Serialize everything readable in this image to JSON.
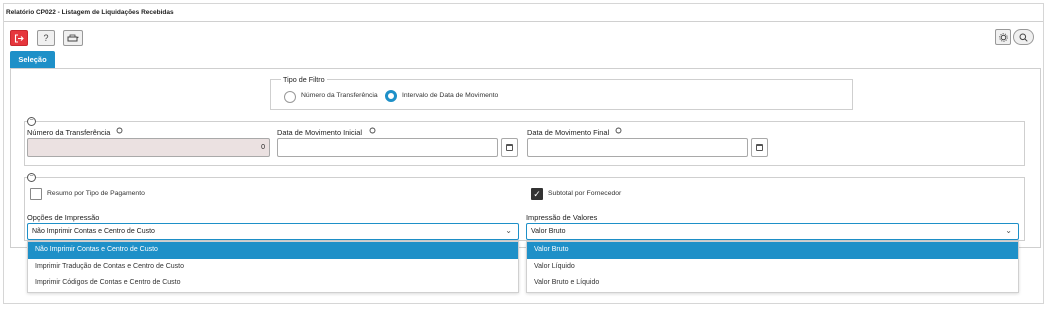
{
  "window": {
    "title": "Relatório CP022 - Listagem de Liquidações Recebidas"
  },
  "toolbar": {
    "exit_icon": "exit-icon",
    "help_label": "?",
    "print_icon": "printer-icon",
    "settings_icon": "gear-icon",
    "search_icon": "search-icon"
  },
  "tabs": [
    {
      "label": "Seleção"
    }
  ],
  "filter_type": {
    "legend": "Tipo de Filtro",
    "options": [
      {
        "label": "Número da Transferência",
        "selected": false
      },
      {
        "label": "Intervalo de Data de Movimento",
        "selected": true
      }
    ]
  },
  "fields": {
    "numero_transferencia": {
      "label": "Número da Transferência",
      "value": "0"
    },
    "data_inicial": {
      "label": "Data de Movimento Inicial",
      "value": ""
    },
    "data_final": {
      "label": "Data de Movimento Final",
      "value": ""
    }
  },
  "options": {
    "resumo_tipo_pagamento": {
      "label": "Resumo por Tipo de Pagamento",
      "checked": false
    },
    "subtotal_fornecedor": {
      "label": "Subtotal por Fornecedor",
      "checked": true
    }
  },
  "opcoes_impressao": {
    "label": "Opções de Impressão",
    "value": "Não Imprimir Contas e Centro de Custo",
    "items": [
      "Não Imprimir Contas e Centro de Custo",
      "Imprimir Tradução de Contas e Centro de Custo",
      "Imprimir Códigos de Contas e Centro de Custo"
    ]
  },
  "impressao_valores": {
    "label": "Impressão de Valores",
    "value": "Valor Bruto",
    "items": [
      "Valor Bruto",
      "Valor Líquido",
      "Valor Bruto e Líquido"
    ]
  },
  "colors": {
    "accent": "#1e90c8",
    "danger": "#e6363d"
  }
}
